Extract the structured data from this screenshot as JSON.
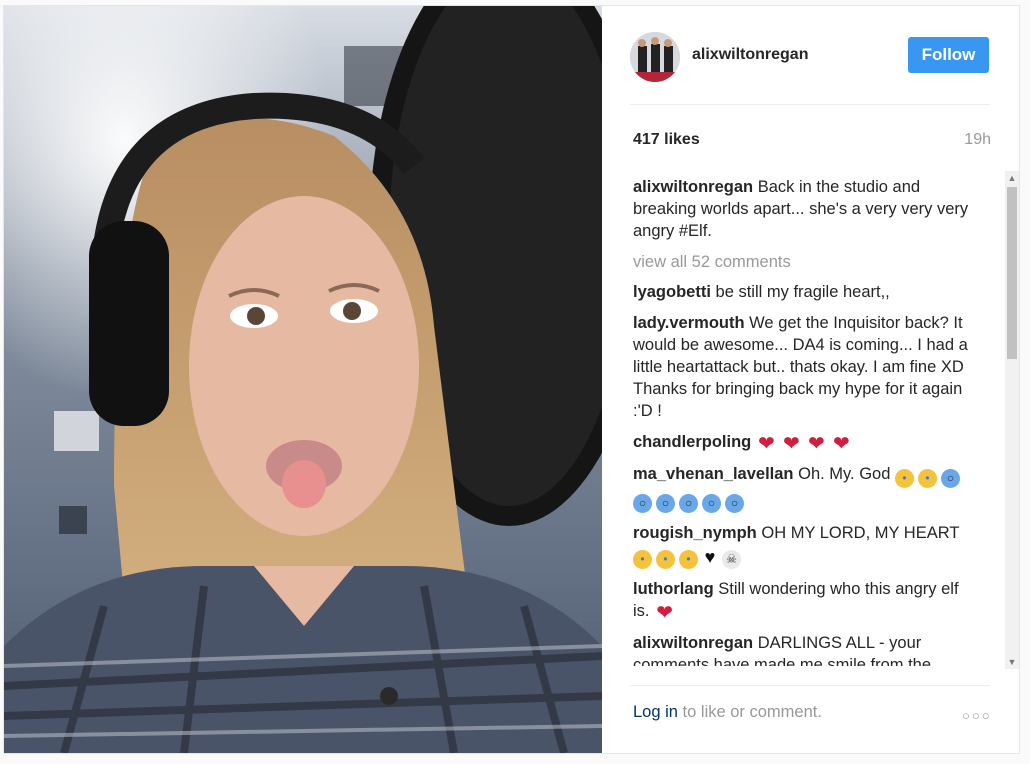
{
  "post": {
    "username": "alixwiltonregan",
    "follow_label": "Follow",
    "likes": "417 likes",
    "time": "19h",
    "caption": "Back in the studio and breaking worlds apart... she's a very very very angry #Elf.",
    "view_all": "view all 52 comments",
    "login_link": "Log in",
    "login_rest": " to like or comment.",
    "more_icon": "more-options-icon",
    "accent": "#3897f0"
  },
  "comments": [
    {
      "user": "lyagobetti",
      "text": "be still my fragile heart,,",
      "emoji": []
    },
    {
      "user": "lady.vermouth",
      "text": "We get the Inquisitor back? It would be awesome... DA4 is coming... I had a little heartattack but.. thats okay. I am fine XD Thanks for bringing back my hype for it again :'D !",
      "emoji": []
    },
    {
      "user": "chandlerpoling",
      "text": "",
      "emoji": [
        "sparkling-heart",
        "sparkling-heart",
        "sparkling-heart",
        "sparkling-heart"
      ]
    },
    {
      "user": "ma_vhenan_lavellan",
      "text": "Oh. My. God",
      "emoji": [
        "crying-face",
        "crying-face",
        "screaming-face",
        "screaming-face",
        "screaming-face",
        "screaming-face",
        "screaming-face",
        "screaming-face"
      ]
    },
    {
      "user": "rougish_nymph",
      "text": "OH MY LORD, MY HEART",
      "emoji": [
        "crying-face",
        "crying-face",
        "crying-face",
        "black-heart",
        "skull"
      ]
    },
    {
      "user": "luthorlang",
      "text": "Still wondering who this angry elf is.",
      "emoji": [
        "heart"
      ]
    },
    {
      "user": "alixwiltonregan",
      "text": "DARLINGS ALL - your comments have made me smile from the",
      "emoji": []
    }
  ]
}
